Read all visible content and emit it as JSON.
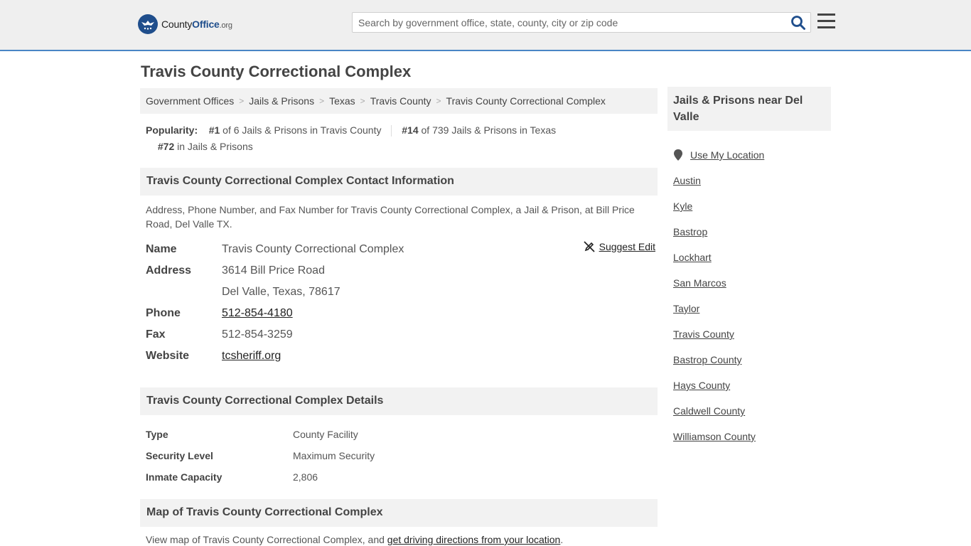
{
  "header": {
    "logo": {
      "brand_a": "County",
      "brand_b": "Office",
      "tld": ".org"
    },
    "search": {
      "placeholder": "Search by government office, state, county, city or zip code"
    },
    "colors": {
      "accent": "#4a86c5",
      "brand": "#1f4e8c"
    }
  },
  "page": {
    "title": "Travis County Correctional Complex"
  },
  "breadcrumb": [
    "Government Offices",
    "Jails & Prisons",
    "Texas",
    "Travis County",
    "Travis County Correctional Complex"
  ],
  "popularity": {
    "label": "Popularity:",
    "items": [
      {
        "rank": "#1",
        "text": "of 6 Jails & Prisons in Travis County"
      },
      {
        "rank": "#14",
        "text": "of 739 Jails & Prisons in Texas"
      },
      {
        "rank": "#72",
        "text": "in Jails & Prisons"
      }
    ]
  },
  "contact": {
    "heading": "Travis County Correctional Complex Contact Information",
    "description": "Address, Phone Number, and Fax Number for Travis County Correctional Complex, a Jail & Prison, at Bill Price Road, Del Valle TX.",
    "suggest_edit": "Suggest Edit",
    "name_label": "Name",
    "name": "Travis County Correctional Complex",
    "address_label": "Address",
    "address_line1": "3614 Bill Price Road",
    "address_line2": "Del Valle, Texas, 78617",
    "phone_label": "Phone",
    "phone": "512-854-4180",
    "fax_label": "Fax",
    "fax": "512-854-3259",
    "website_label": "Website",
    "website": "tcsheriff.org"
  },
  "details": {
    "heading": "Travis County Correctional Complex Details",
    "rows": [
      {
        "label": "Type",
        "value": "County Facility"
      },
      {
        "label": "Security Level",
        "value": "Maximum Security"
      },
      {
        "label": "Inmate Capacity",
        "value": "2,806"
      }
    ]
  },
  "map": {
    "heading": "Map of Travis County Correctional Complex",
    "desc_prefix": "View map of Travis County Correctional Complex, and ",
    "desc_link": "get driving directions from your location",
    "desc_suffix": "."
  },
  "sidebar": {
    "heading": "Jails & Prisons near Del Valle",
    "use_location": "Use My Location",
    "links": [
      "Austin",
      "Kyle",
      "Bastrop",
      "Lockhart",
      "San Marcos",
      "Taylor",
      "Travis County",
      "Bastrop County",
      "Hays County",
      "Caldwell County",
      "Williamson County"
    ]
  }
}
